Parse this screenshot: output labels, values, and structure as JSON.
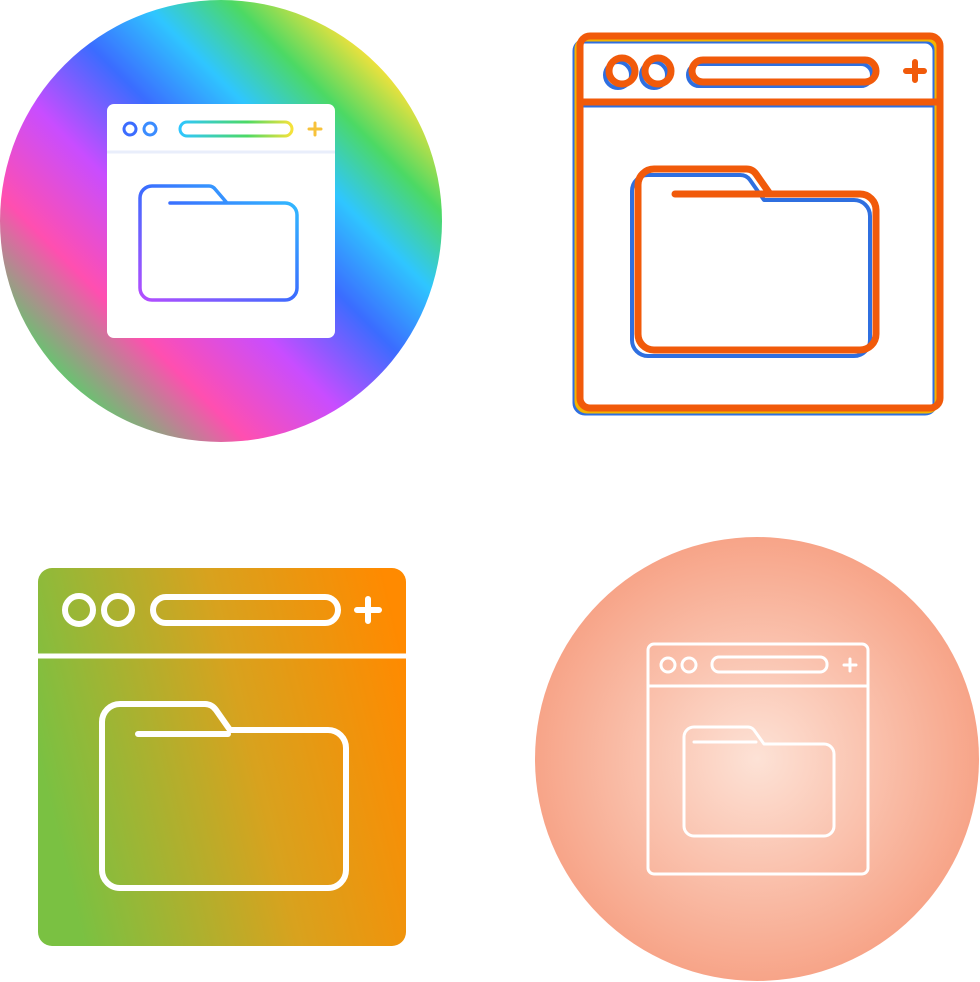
{
  "icons": [
    {
      "name": "browser-folder-icon",
      "style": "gradient-circle",
      "colors": [
        "#ff3b3b",
        "#ff9a2e",
        "#f7e23a",
        "#4cd964",
        "#2fc6ff",
        "#3b6cff",
        "#c84dff",
        "#ff4fb0"
      ]
    },
    {
      "name": "browser-folder-icon",
      "style": "outline-offset",
      "colors": [
        "#f15a0a",
        "#2f6fe0",
        "#f4b400"
      ]
    },
    {
      "name": "browser-folder-icon",
      "style": "gradient-solid",
      "colors": [
        "#7ac142",
        "#ff8a00",
        "#e2a21a"
      ]
    },
    {
      "name": "browser-folder-icon",
      "style": "soft-circle",
      "colors": [
        "#fde2d6",
        "#f7a488",
        "#ffffff"
      ]
    }
  ]
}
